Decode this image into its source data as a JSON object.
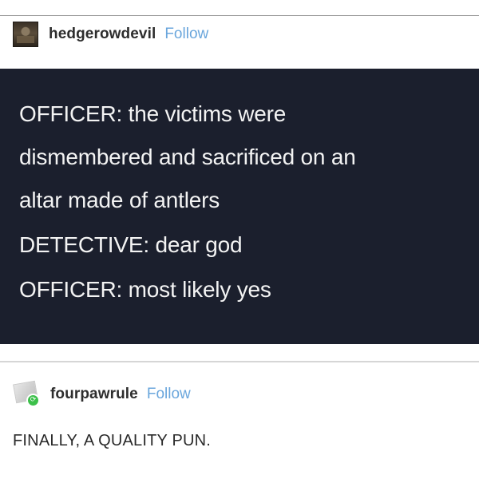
{
  "post1": {
    "username": "hedgerowdevil",
    "follow_label": "Follow",
    "lines": [
      "OFFICER: the victims were",
      "dismembered and sacrificed on an",
      "altar made of antlers",
      "DETECTIVE: dear god",
      "OFFICER: most likely yes"
    ]
  },
  "post2": {
    "username": "fourpawrule",
    "follow_label": "Follow",
    "text": "FINALLY, A QUALITY PUN.",
    "badge_icon": "reblog-icon"
  },
  "colors": {
    "panel_bg": "#1b1f2d",
    "panel_text": "#f3f3f3",
    "follow_link": "#6aa6dc",
    "badge_green": "#3cc04a"
  }
}
